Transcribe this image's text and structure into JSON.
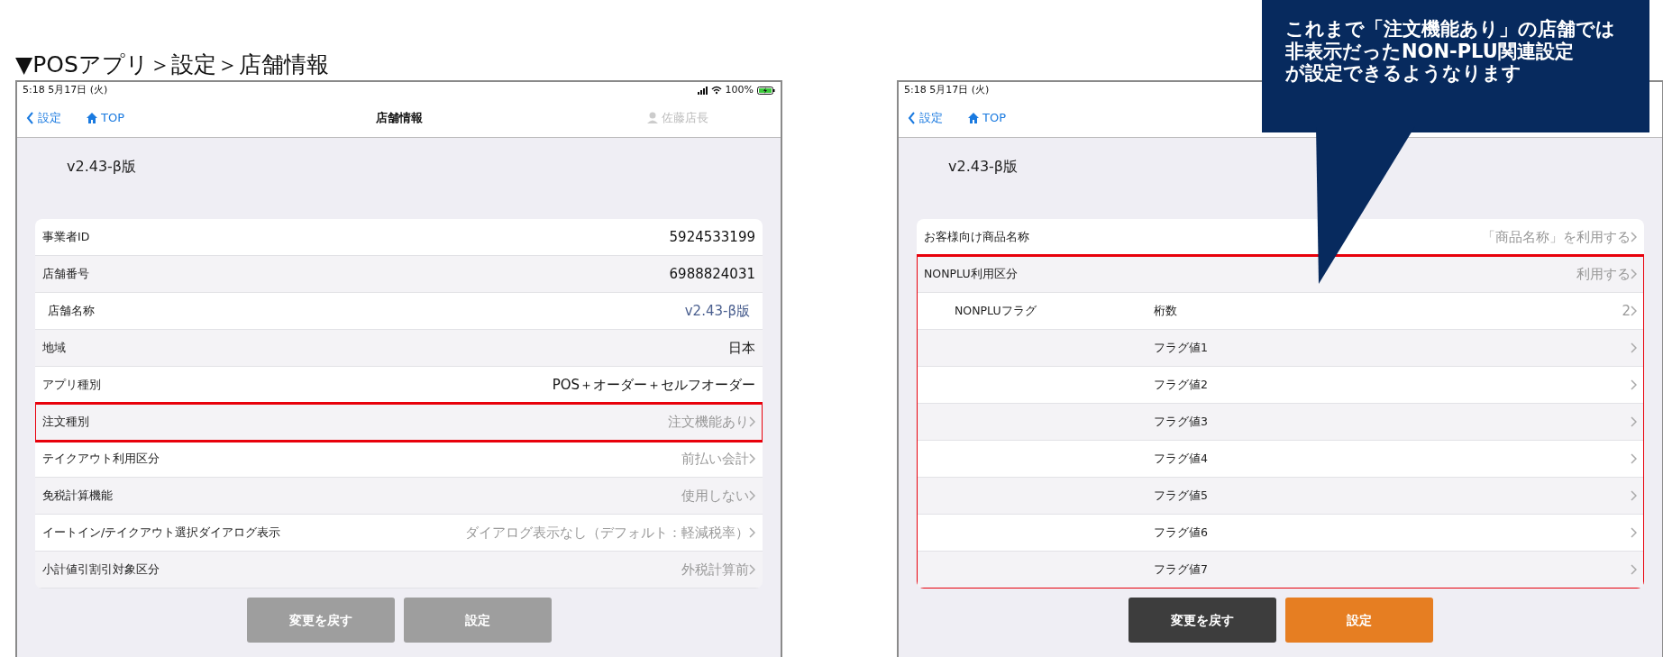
{
  "caption": "▼POSアプリ＞設定＞店舗情報",
  "screens": [
    {
      "status_bar": {
        "time": "5:18  5月17日 (火)",
        "battery": "100%"
      },
      "nav": {
        "back": "設定",
        "home": "TOP",
        "title": "店舗情報",
        "user": "佐藤店長"
      },
      "version": "v2.43-β版",
      "rows": [
        {
          "label": "事業者ID",
          "value": "5924533199",
          "kind": "value",
          "highlighted": false
        },
        {
          "label": "店舗番号",
          "value": "6988824031",
          "kind": "value",
          "highlighted": false
        },
        {
          "label": "店舗名称",
          "value": "v2.43-β版",
          "kind": "link",
          "highlighted": false
        },
        {
          "label": "地域",
          "value": "日本",
          "kind": "value",
          "highlighted": false
        },
        {
          "label": "アプリ種別",
          "value": "POS＋オーダー＋セルフオーダー",
          "kind": "value",
          "highlighted": false
        },
        {
          "label": "注文種別",
          "value": "注文機能あり",
          "kind": "disclosure",
          "highlighted": true
        },
        {
          "label": "テイクアウト利用区分",
          "value": "前払い会計",
          "kind": "disclosure",
          "highlighted": false
        },
        {
          "label": "免税計算機能",
          "value": "使用しない",
          "kind": "disclosure",
          "highlighted": false
        },
        {
          "label": "イートイン/テイクアウト選択ダイアログ表示",
          "value": "ダイアログ表示なし（デフォルト：軽減税率）",
          "kind": "disclosure",
          "highlighted": false
        },
        {
          "label": "小計値引割引対象区分",
          "value": "外税計算前",
          "kind": "disclosure",
          "highlighted": false
        }
      ],
      "buttons": [
        {
          "label": "変更を戻す",
          "kind": "secondary",
          "disabled": true
        },
        {
          "label": "設定",
          "kind": "primary",
          "disabled": true
        }
      ]
    },
    {
      "status_bar": {
        "time": "5:18  5月17日 (火)"
      },
      "nav": {
        "back": "設定",
        "home": "TOP"
      },
      "version": "v2.43-β版",
      "rows": [
        {
          "label": "お客様向け商品名称",
          "value": "「商品名称」を利用する",
          "kind": "disclosure",
          "highlighted": false
        },
        {
          "label": "NONPLU利用区分",
          "value": "利用する",
          "kind": "disclosure",
          "highlighted": true
        },
        {
          "label": "NONPLUフラグ",
          "sublabel": "桁数",
          "value": "2",
          "kind": "disclosure",
          "highlighted": true
        },
        {
          "sublabel": "フラグ値1",
          "kind": "disclosure",
          "highlighted": true
        },
        {
          "sublabel": "フラグ値2",
          "kind": "disclosure",
          "highlighted": true
        },
        {
          "sublabel": "フラグ値3",
          "kind": "disclosure",
          "highlighted": true
        },
        {
          "sublabel": "フラグ値4",
          "kind": "disclosure",
          "highlighted": true
        },
        {
          "sublabel": "フラグ値5",
          "kind": "disclosure",
          "highlighted": true
        },
        {
          "sublabel": "フラグ値6",
          "kind": "disclosure",
          "highlighted": true
        },
        {
          "sublabel": "フラグ値7",
          "kind": "disclosure",
          "highlighted": true
        }
      ],
      "buttons": [
        {
          "label": "変更を戻す",
          "kind": "secondary",
          "disabled": false
        },
        {
          "label": "設定",
          "kind": "primary",
          "disabled": false
        }
      ]
    }
  ],
  "callout": {
    "lines": [
      "これまで「注文機能あり」の店舗では",
      "非表示だったNON-PLU関連設定",
      "が設定できるようなります"
    ]
  }
}
